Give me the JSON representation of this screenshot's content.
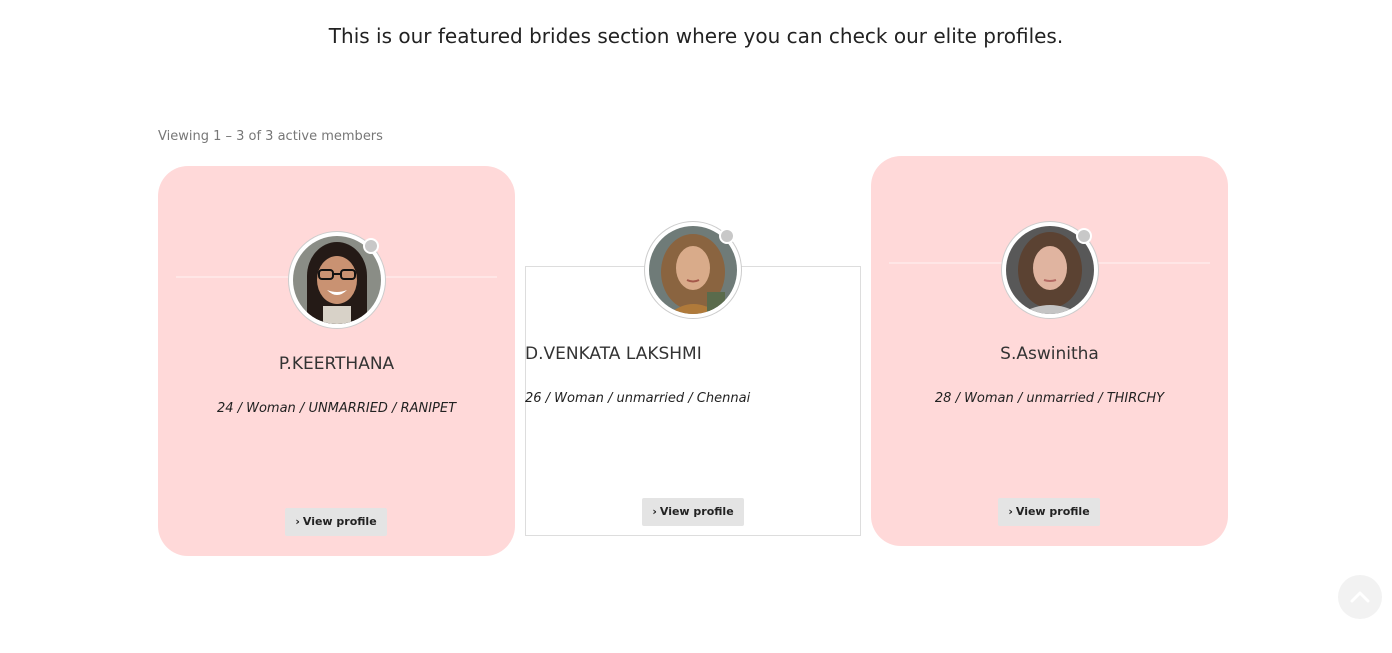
{
  "intro_text": "This is our featured brides section where you can check our elite profiles.",
  "viewing_text": "Viewing 1 – 3 of 3 active members",
  "profiles": [
    {
      "name": "P.KEERTHANA",
      "details": "24 / Woman / UNMARRIED / RANIPET",
      "button_label": "View profile",
      "status_icon": "status-dot-icon"
    },
    {
      "name": "D.VENKATA LAKSHMI",
      "details": "26 / Woman / unmarried / Chennai",
      "button_label": "View profile",
      "status_icon": "status-dot-icon"
    },
    {
      "name": "S.Aswinitha",
      "details": "28 / Woman / unmarried / THIRCHY",
      "button_label": "View profile",
      "status_icon": "status-dot-icon"
    }
  ],
  "colors": {
    "card_pink": "#ffd9d9",
    "button_bg": "#e4e4e4",
    "status_dot": "#c8c8c8"
  },
  "scroll_top_icon": "chevron-up-icon"
}
